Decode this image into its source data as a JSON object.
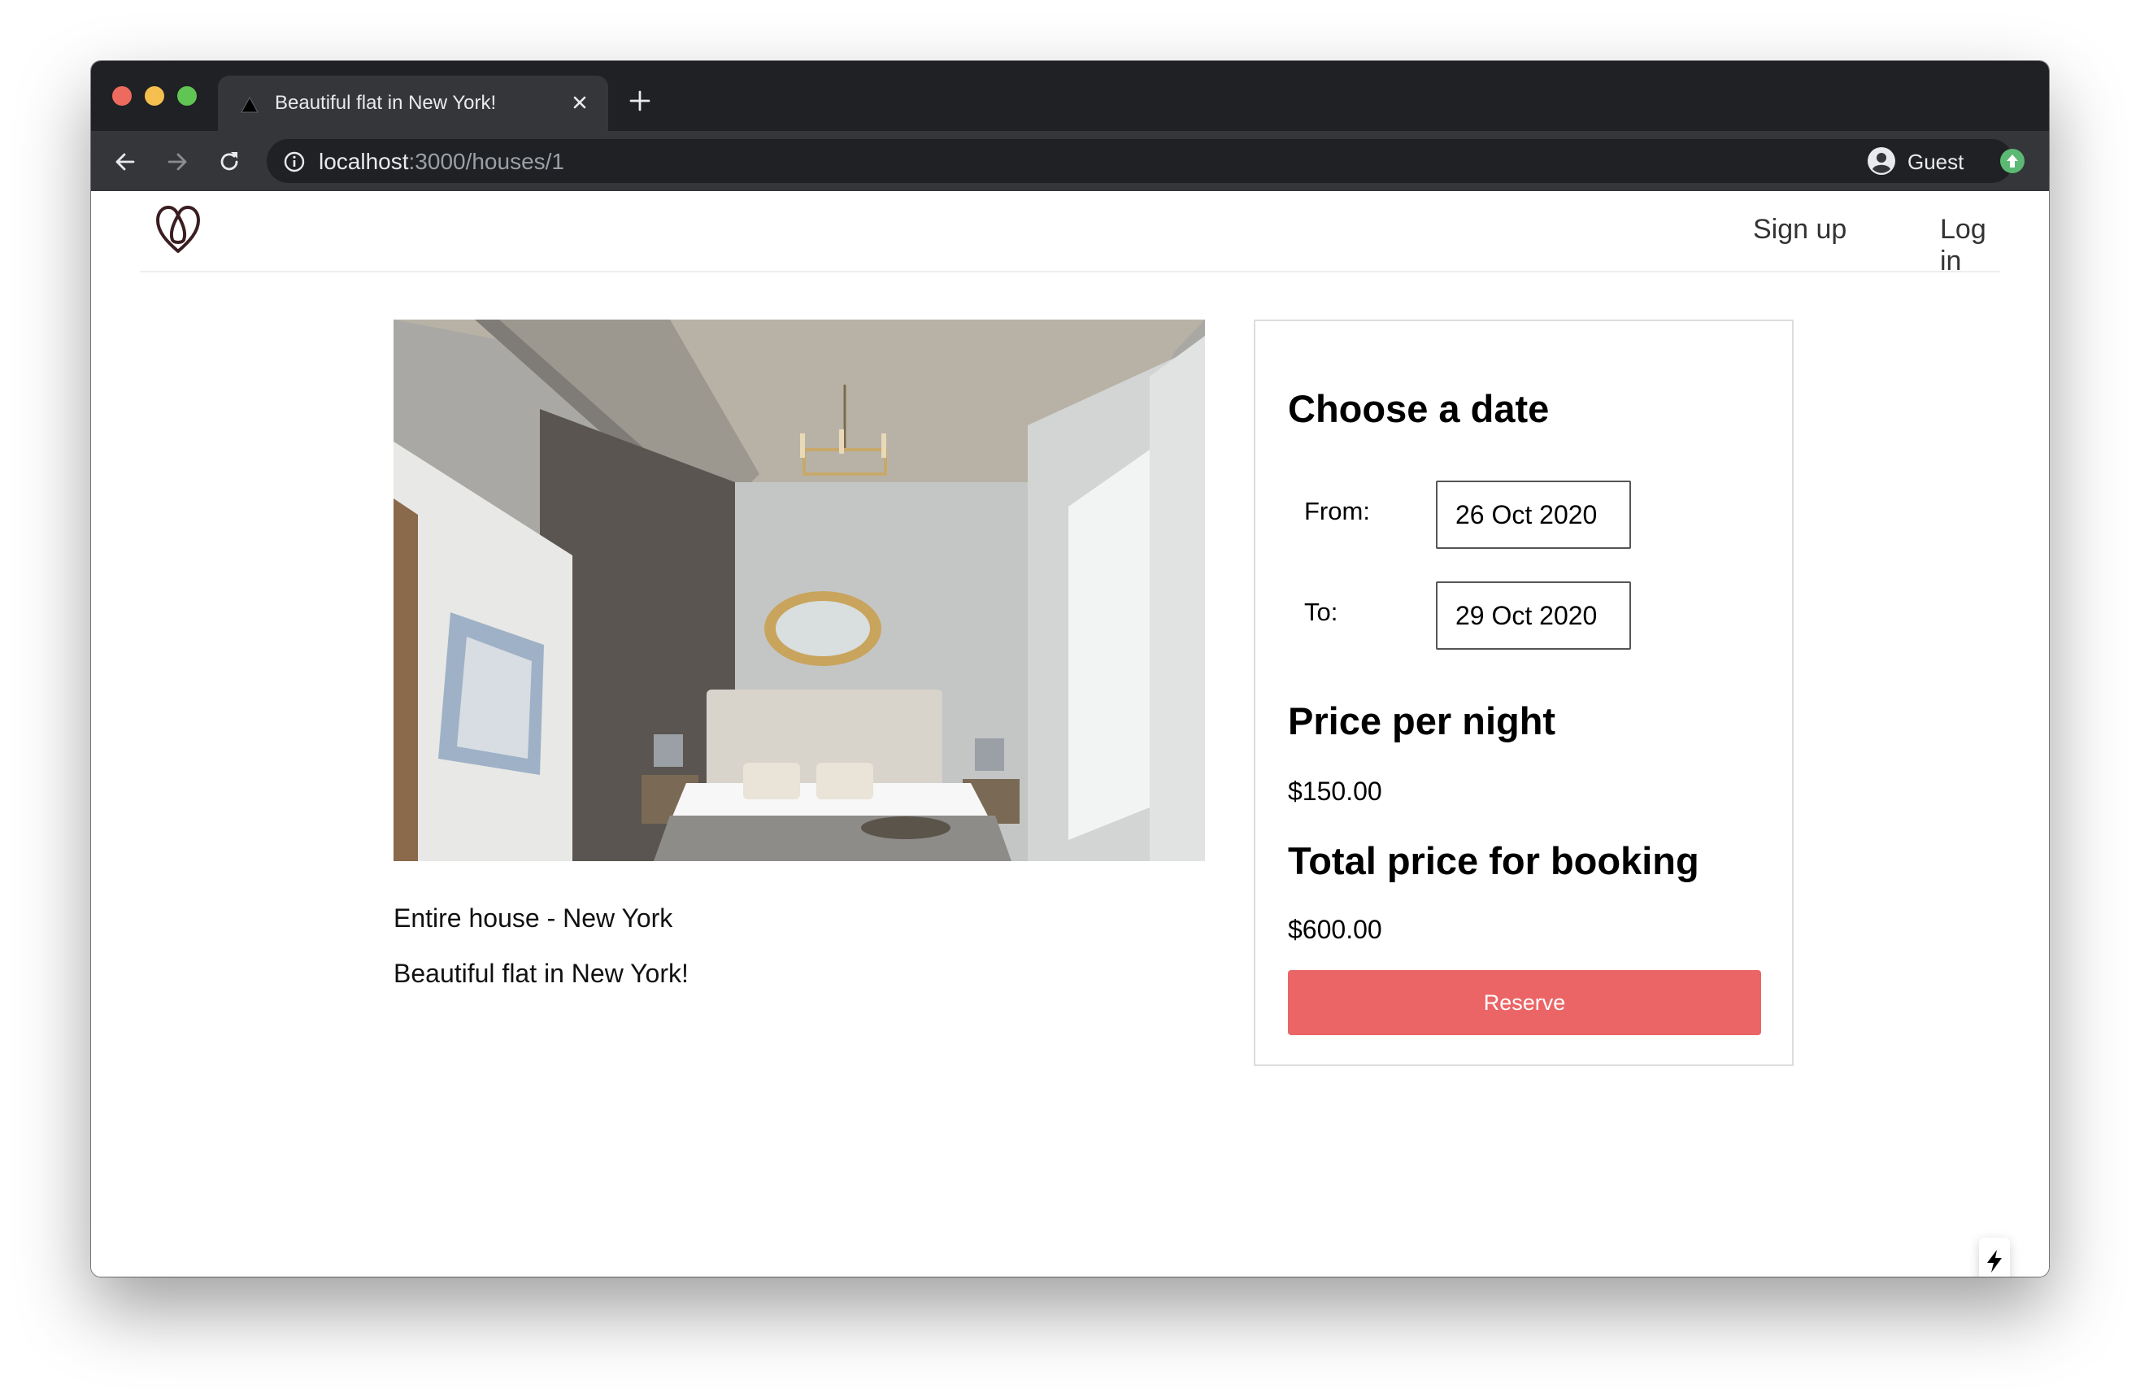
{
  "browser": {
    "tab_title": "Beautiful flat in New York!",
    "url_host": "localhost",
    "url_path": ":3000/houses/1",
    "profile_name": "Guest"
  },
  "nav": {
    "signup": "Sign up",
    "login": "Log in"
  },
  "house": {
    "type": "Entire house - New York",
    "title": "Beautiful flat in New York!"
  },
  "booking": {
    "heading": "Choose a date",
    "from_label": "From:",
    "from_value": "26 Oct 2020",
    "to_label": "To:",
    "to_value": "29 Oct 2020",
    "price_heading": "Price per night",
    "price_value": "$150.00",
    "total_heading": "Total price for booking",
    "total_value": "$600.00",
    "reserve_label": "Reserve"
  },
  "colors": {
    "reserve_button": "#eb6566",
    "browser_chrome": "#35363a"
  }
}
